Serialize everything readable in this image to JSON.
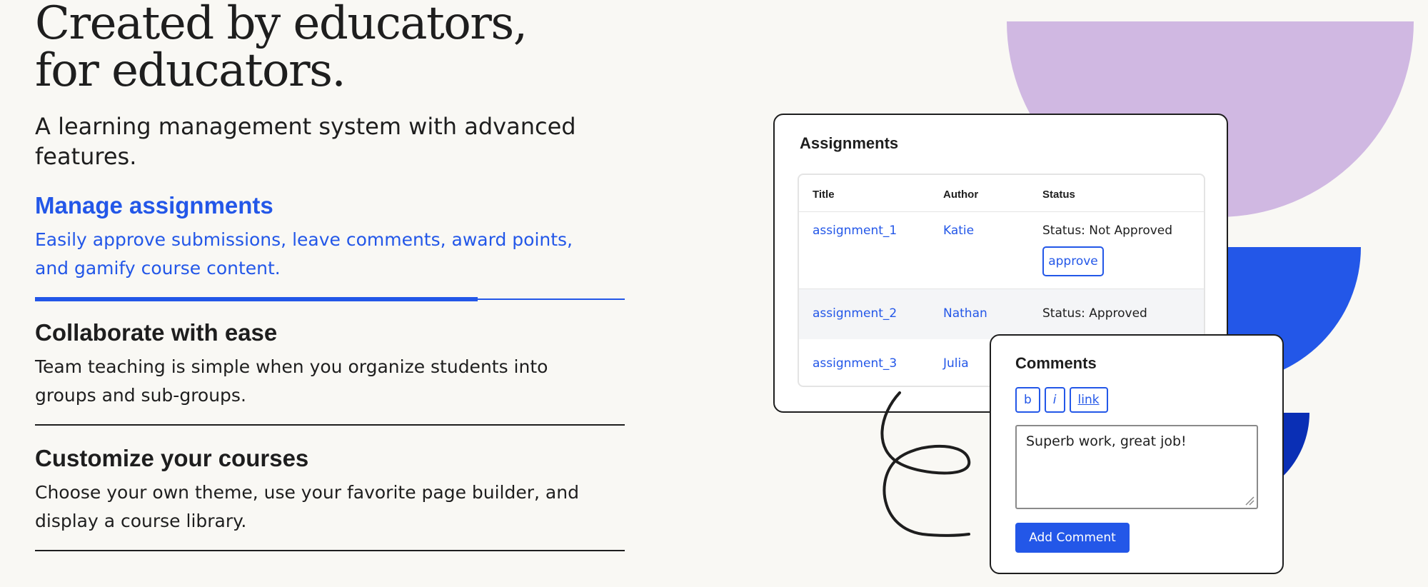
{
  "hero": {
    "headline": "Created by educators, for educators.",
    "lede": "A learning management system with advanced features."
  },
  "features": [
    {
      "title": "Manage assignments",
      "body": "Easily approve submissions, leave comments, award points, and gamify course content.",
      "active": true,
      "progress": 0.75
    },
    {
      "title": "Collaborate with ease",
      "body": "Team teaching is simple when you organize students into groups and sub-groups.",
      "active": false
    },
    {
      "title": "Customize your courses",
      "body": "Choose your own theme, use your favorite page builder, and display a course library.",
      "active": false
    }
  ],
  "assignments": {
    "title": "Assignments",
    "columns": [
      "Title",
      "Author",
      "Status"
    ],
    "rows": [
      {
        "title": "assignment_1",
        "author": "Katie",
        "status": "Status: Not Approved",
        "action": "approve"
      },
      {
        "title": "assignment_2",
        "author": "Nathan",
        "status": "Status: Approved"
      },
      {
        "title": "assignment_3",
        "author": "Julia",
        "status": ""
      }
    ]
  },
  "comments": {
    "title": "Comments",
    "format_buttons": [
      "b",
      "i",
      "link"
    ],
    "value": "Superb work, great job!",
    "submit_label": "Add Comment"
  },
  "colors": {
    "accent": "#2357e8",
    "purple": "#d0b8e2",
    "navy": "#0a2fb5",
    "background": "#f9f8f4",
    "text": "#1e1e1e"
  }
}
